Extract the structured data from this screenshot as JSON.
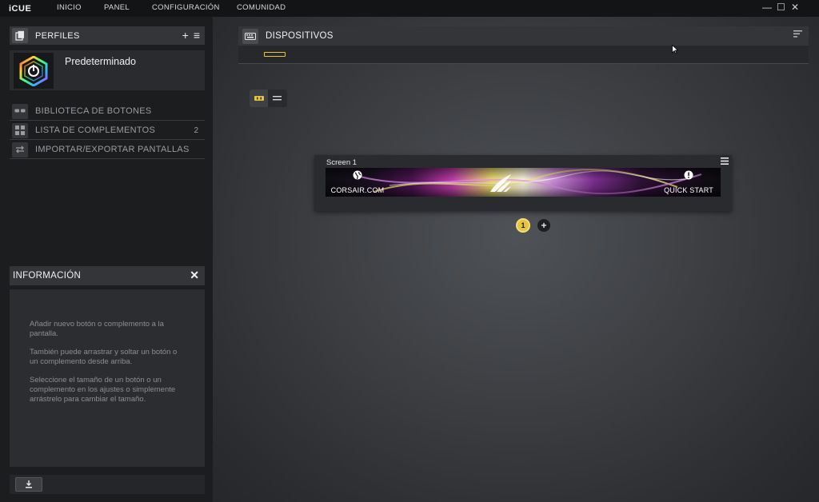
{
  "app": {
    "title": "iCUE"
  },
  "nav": [
    {
      "label": "INICIO"
    },
    {
      "label": "PANEL"
    },
    {
      "label": "CONFIGURACIÓN"
    },
    {
      "label": "COMUNIDAD"
    }
  ],
  "window_controls": {
    "minimize": "—",
    "maximize": "☐",
    "close": "✕"
  },
  "profiles": {
    "header": "PERFILES",
    "add": "+",
    "menu": "≡",
    "current": "Predeterminado"
  },
  "menu": [
    {
      "label": "BIBLIOTECA DE BOTONES",
      "count": "",
      "icon": "button-library-icon"
    },
    {
      "label": "LISTA DE COMPLEMENTOS",
      "count": "2",
      "icon": "grid-icon"
    },
    {
      "label": "IMPORTAR/EXPORTAR PANTALLAS",
      "count": "",
      "icon": "import-export-icon"
    }
  ],
  "info": {
    "title": "INFORMACIÓN",
    "close": "✕",
    "paragraphs": [
      "Añadir nuevo botón o complemento a la pantalla.",
      "También puede arrastrar y soltar un botón o un complemento desde arriba.",
      "Seleccione el tamaño de un botón o un complemento en los ajustes o simplemente arrástrelo para cambiar el tamaño."
    ]
  },
  "devices": {
    "title": "DISPOSITIVOS"
  },
  "screen": {
    "title": "Screen 1",
    "left_button": "CORSAIR.COM",
    "right_button": "QUICK START"
  },
  "pager": {
    "current": "1",
    "add": "+"
  },
  "colors": {
    "accent": "#e6c43b",
    "panel": "#333538",
    "background": "#1b1c1e"
  }
}
